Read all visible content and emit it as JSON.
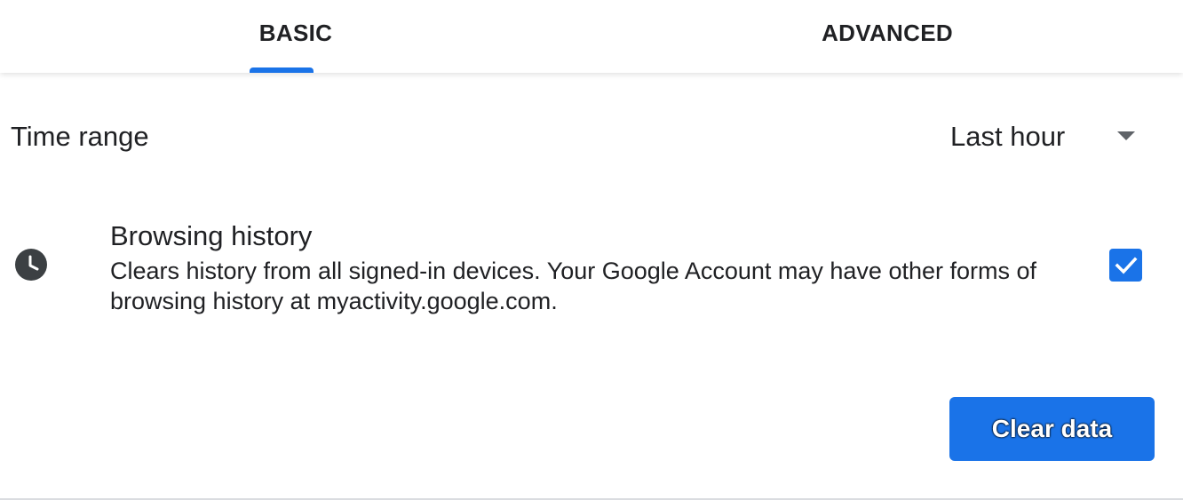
{
  "tabs": {
    "basic_label": "BASIC",
    "advanced_label": "ADVANCED",
    "selected": "BASIC"
  },
  "time_range": {
    "label": "Time range",
    "selected_value": "Last hour"
  },
  "browsing_history": {
    "title": "Browsing history",
    "description": "Clears history from all signed-in devices. Your Google Account may have other forms of browsing history at myactivity.google.com.",
    "checked": true,
    "icon": "clock-icon"
  },
  "actions": {
    "clear_label": "Clear data"
  },
  "colors": {
    "accent": "#1a73e8",
    "text": "#202124",
    "icon": "#3c4043"
  }
}
